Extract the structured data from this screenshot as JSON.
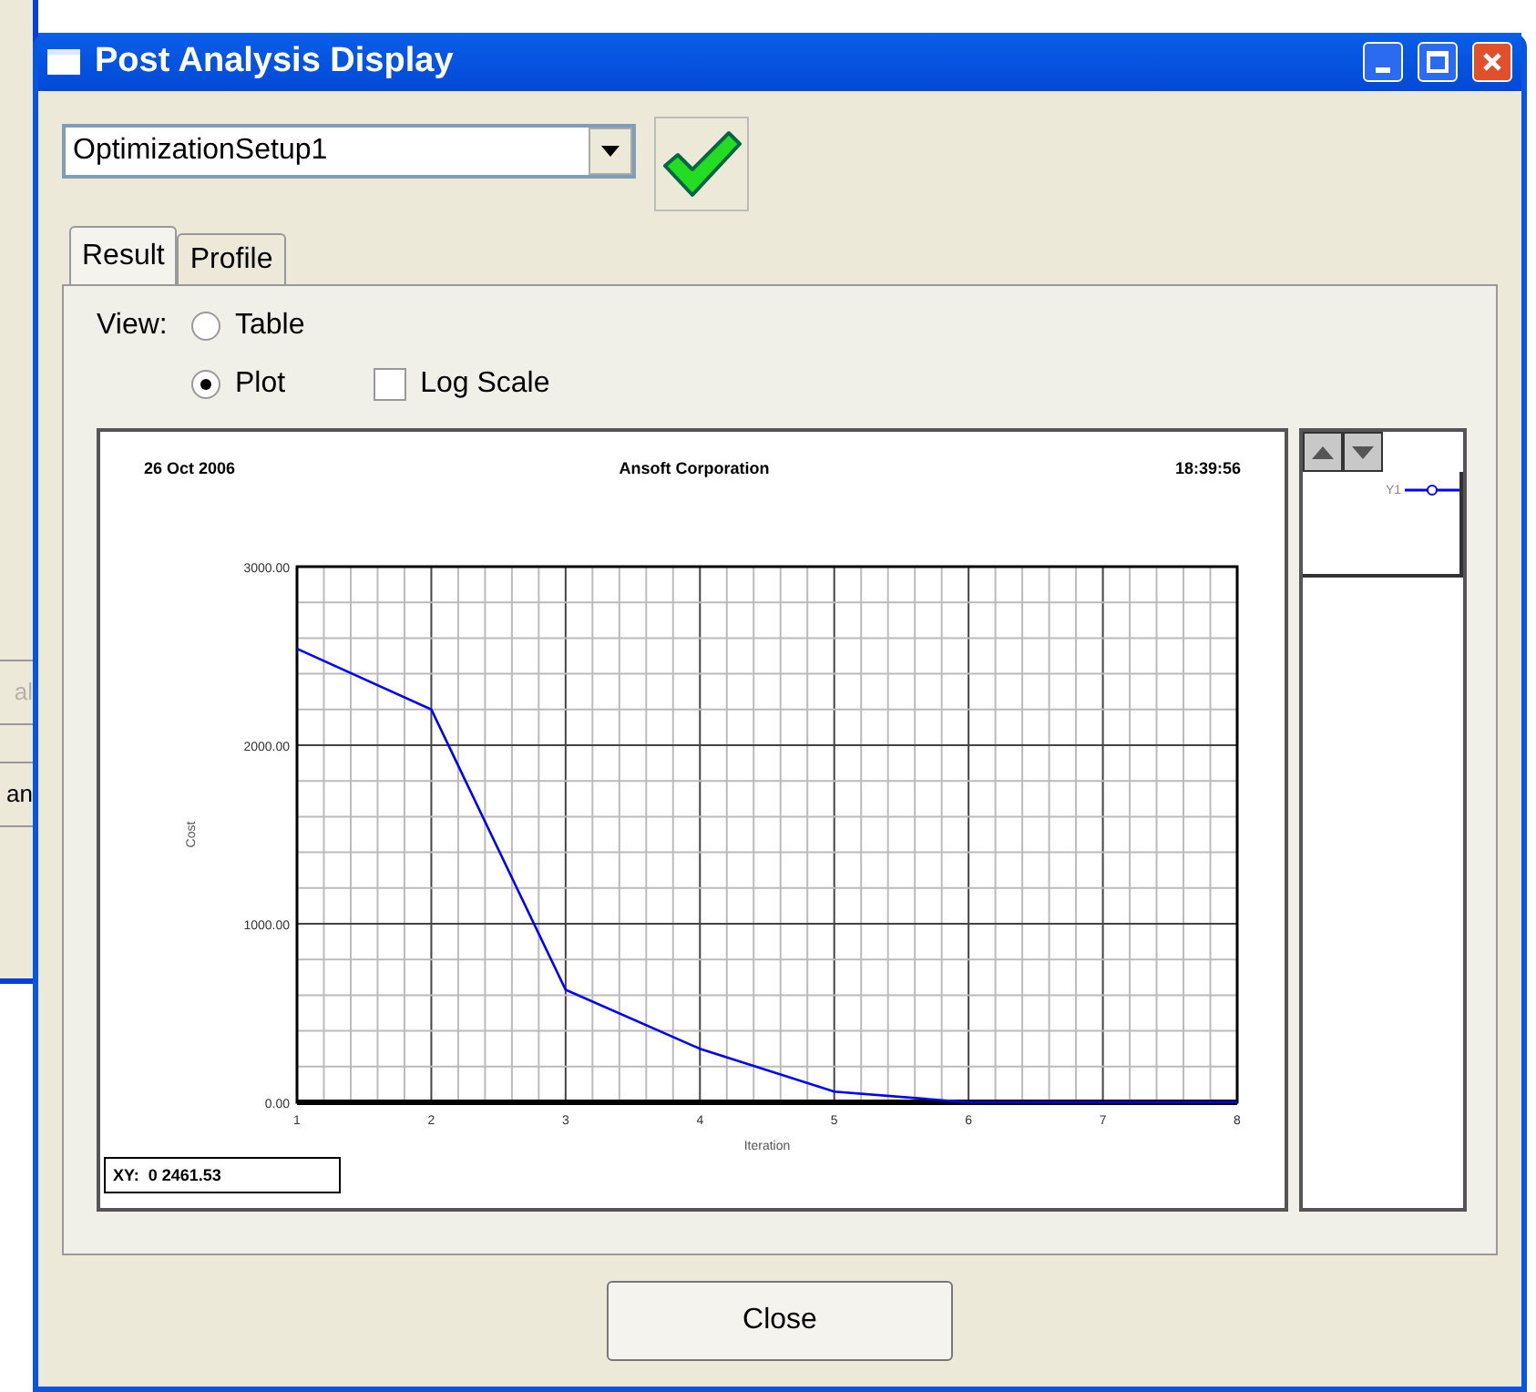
{
  "background_window": {
    "buttons": [
      {
        "label": "al",
        "disabled": true
      },
      {
        "label": "an",
        "disabled": false
      }
    ]
  },
  "window": {
    "title": "Post Analysis Display"
  },
  "setup_select": {
    "value": "OptimizationSetup1"
  },
  "tabs": [
    {
      "label": "Result",
      "selected": true
    },
    {
      "label": "Profile",
      "selected": false
    }
  ],
  "view": {
    "label": "View:",
    "options": [
      {
        "label": "Table",
        "selected": false
      },
      {
        "label": "Plot",
        "selected": true
      }
    ]
  },
  "log_scale": {
    "label": "Log Scale",
    "checked": false
  },
  "plot": {
    "date": "26 Oct 2006",
    "company": "Ansoft Corporation",
    "time": "18:39:56",
    "readout": "XY:  0 2461.53",
    "chart_data": {
      "type": "line",
      "xlabel": "Iteration",
      "ylabel": "Cost",
      "x": [
        1,
        2,
        3,
        4,
        5,
        6,
        7,
        8
      ],
      "series": [
        {
          "name": "Y1",
          "color": "#0000ff",
          "values": [
            2540,
            2200,
            630,
            300,
            60,
            0,
            0,
            0
          ]
        }
      ],
      "grid": true,
      "xlim": [
        1,
        8
      ],
      "ylim": [
        0,
        3000
      ],
      "xticks": [
        1,
        2,
        3,
        4,
        5,
        6,
        7,
        8
      ],
      "yticks": [
        {
          "value": 0,
          "label": "0.00"
        },
        {
          "value": 1000,
          "label": "1000.00"
        },
        {
          "value": 2000,
          "label": "2000.00"
        },
        {
          "value": 3000,
          "label": "3000.00"
        }
      ]
    }
  },
  "close_button": {
    "label": "Close"
  }
}
